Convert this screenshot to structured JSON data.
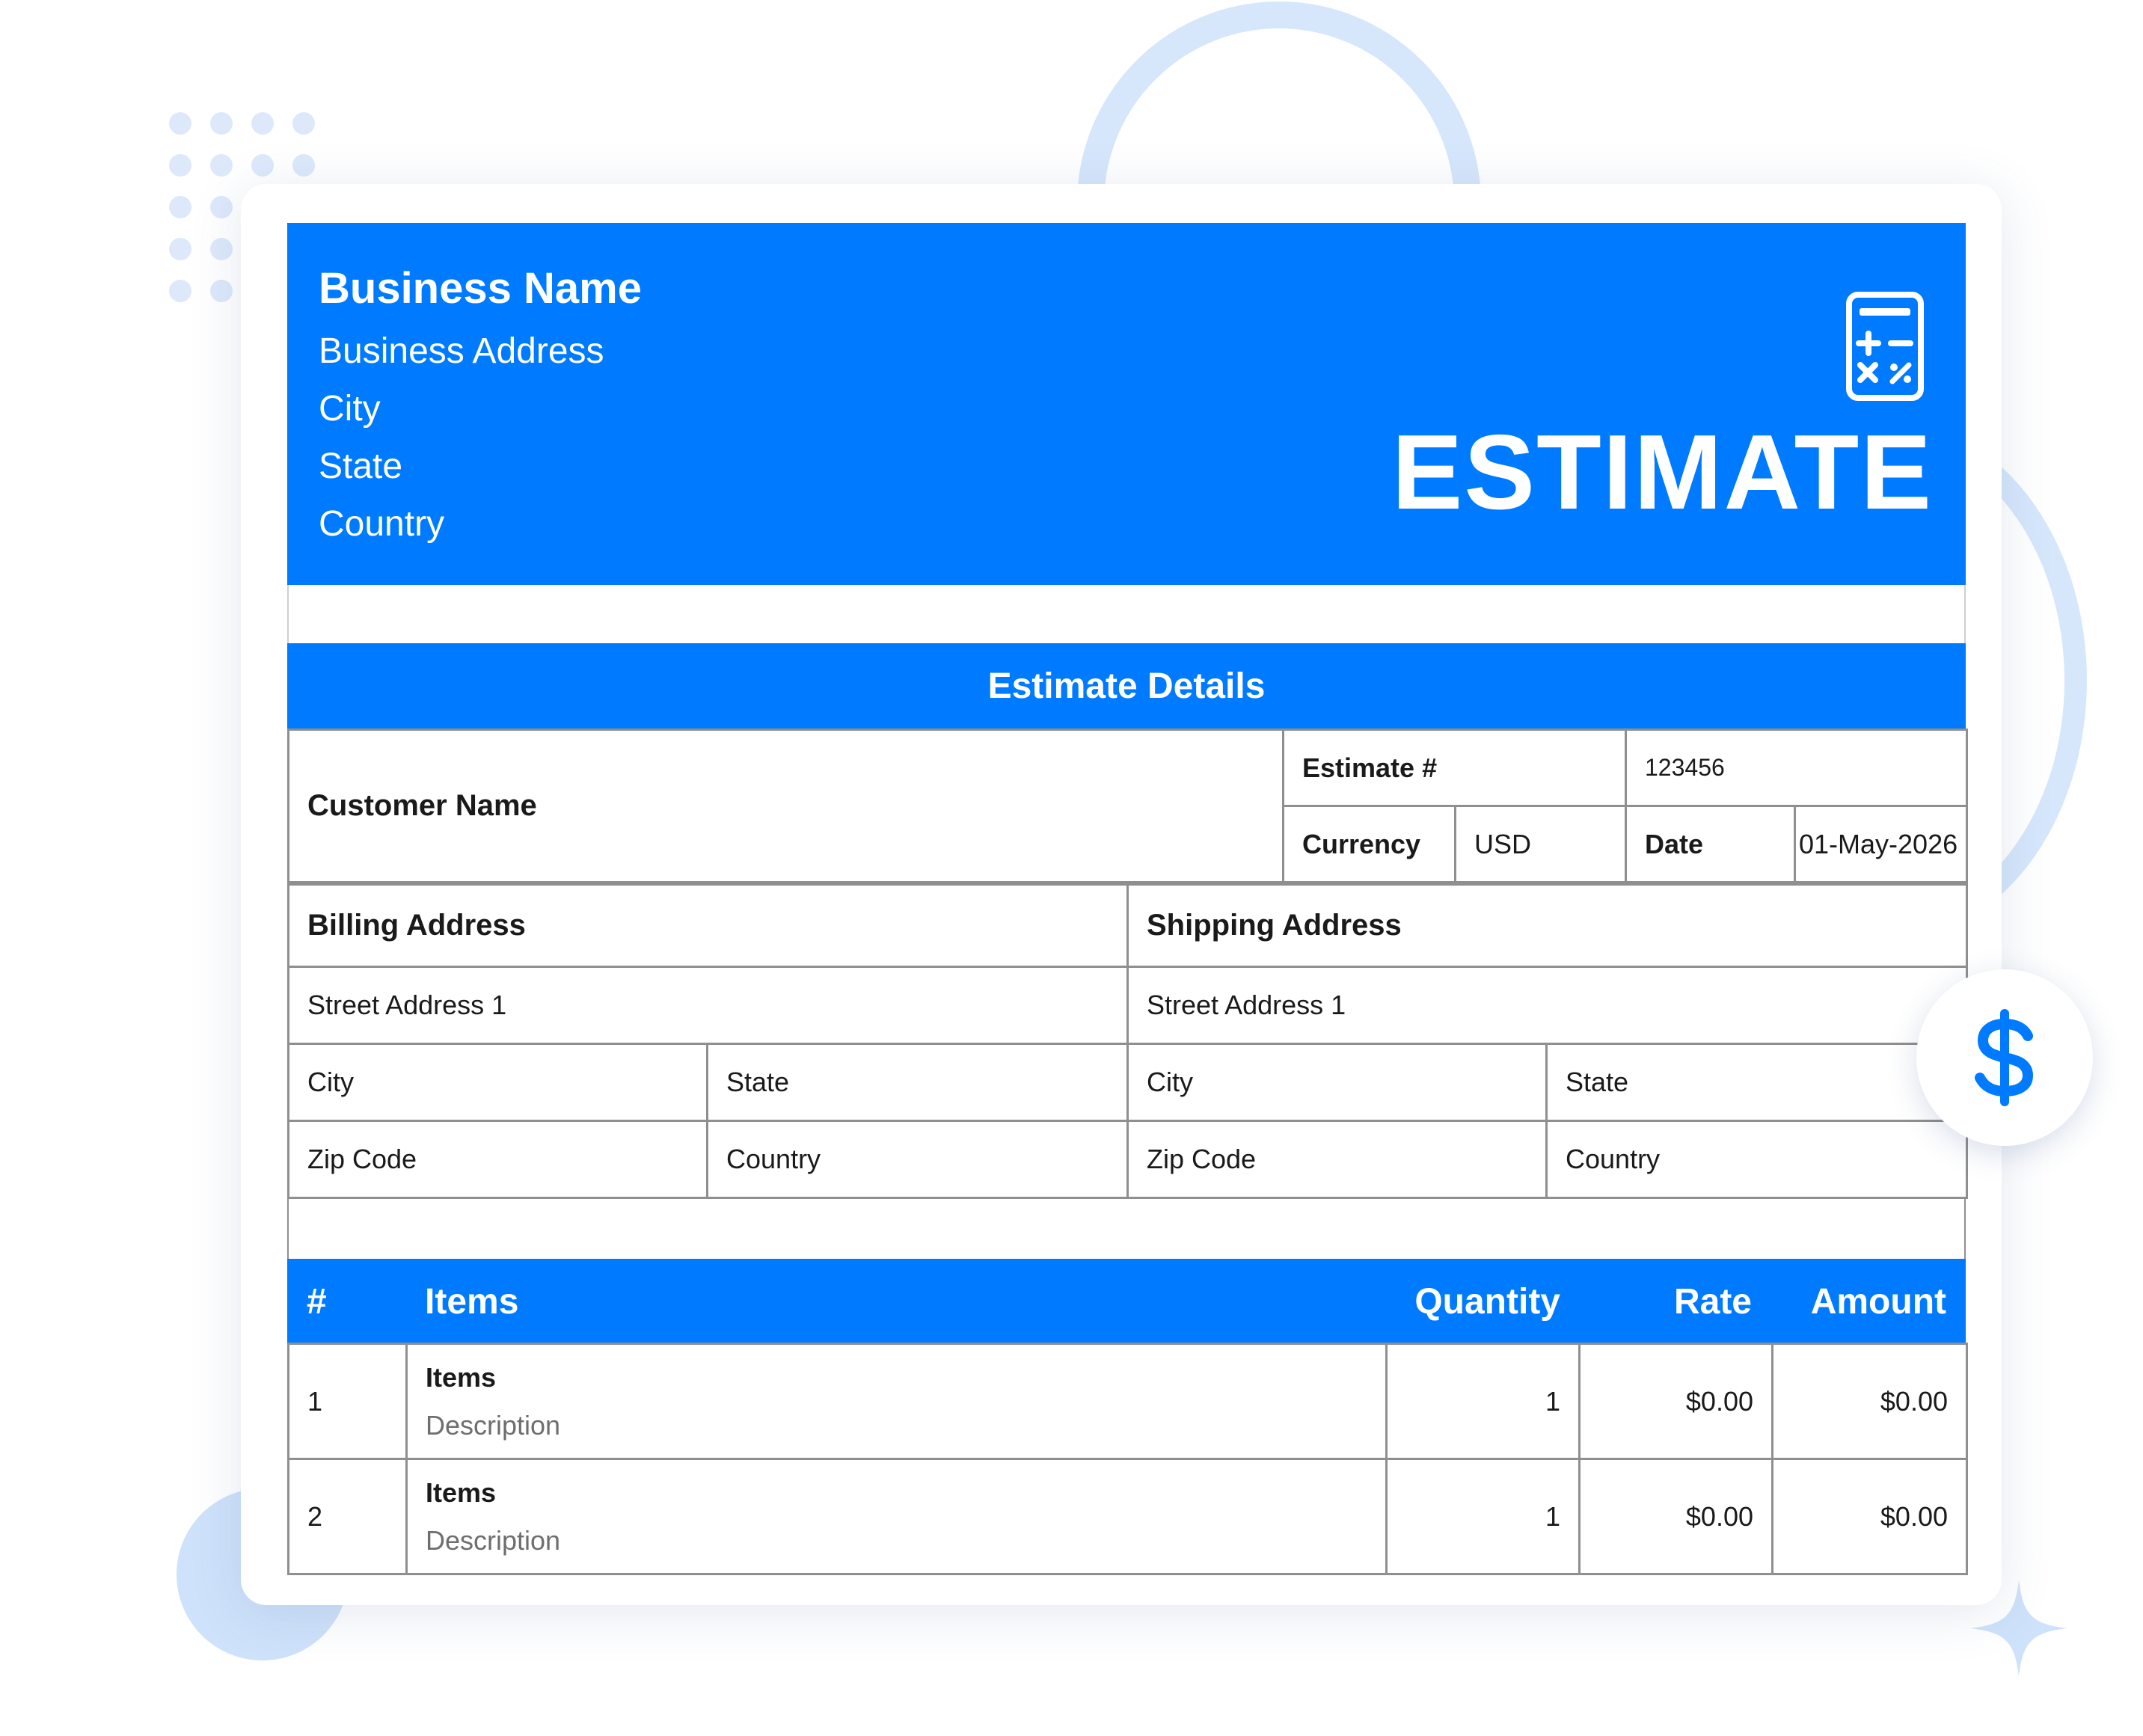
{
  "colors": {
    "brand": "#007bff",
    "decor": "#d6e7fc"
  },
  "header": {
    "business_name": "Business Name",
    "business_address": "Business Address",
    "city": "City",
    "state": "State",
    "country": "Country",
    "title": "ESTIMATE",
    "icon": "calculator-icon"
  },
  "details": {
    "section_title": "Estimate Details",
    "customer_name_label": "Customer Name",
    "estimate_number_label": "Estimate #",
    "estimate_number_value": "123456",
    "currency_label": "Currency",
    "currency_value": "USD",
    "date_label": "Date",
    "date_value": "01-May-2026"
  },
  "billing": {
    "title": "Billing Address",
    "street": "Street Address 1",
    "city": "City",
    "state": "State",
    "zip": "Zip Code",
    "country": "Country"
  },
  "shipping": {
    "title": "Shipping Address",
    "street": "Street Address 1",
    "city": "City",
    "state": "State",
    "zip": "Zip Code",
    "country": "Country"
  },
  "items_table": {
    "headers": {
      "num": "#",
      "items": "Items",
      "quantity": "Quantity",
      "rate": "Rate",
      "amount": "Amount"
    },
    "rows": [
      {
        "num": "1",
        "title": "Items",
        "description": "Description",
        "quantity": "1",
        "rate": "$0.00",
        "amount": "$0.00"
      },
      {
        "num": "2",
        "title": "Items",
        "description": "Description",
        "quantity": "1",
        "rate": "$0.00",
        "amount": "$0.00"
      }
    ]
  },
  "decorations": {
    "badge_icon": "dollar-icon",
    "sparkle_icon": "sparkle-icon"
  }
}
